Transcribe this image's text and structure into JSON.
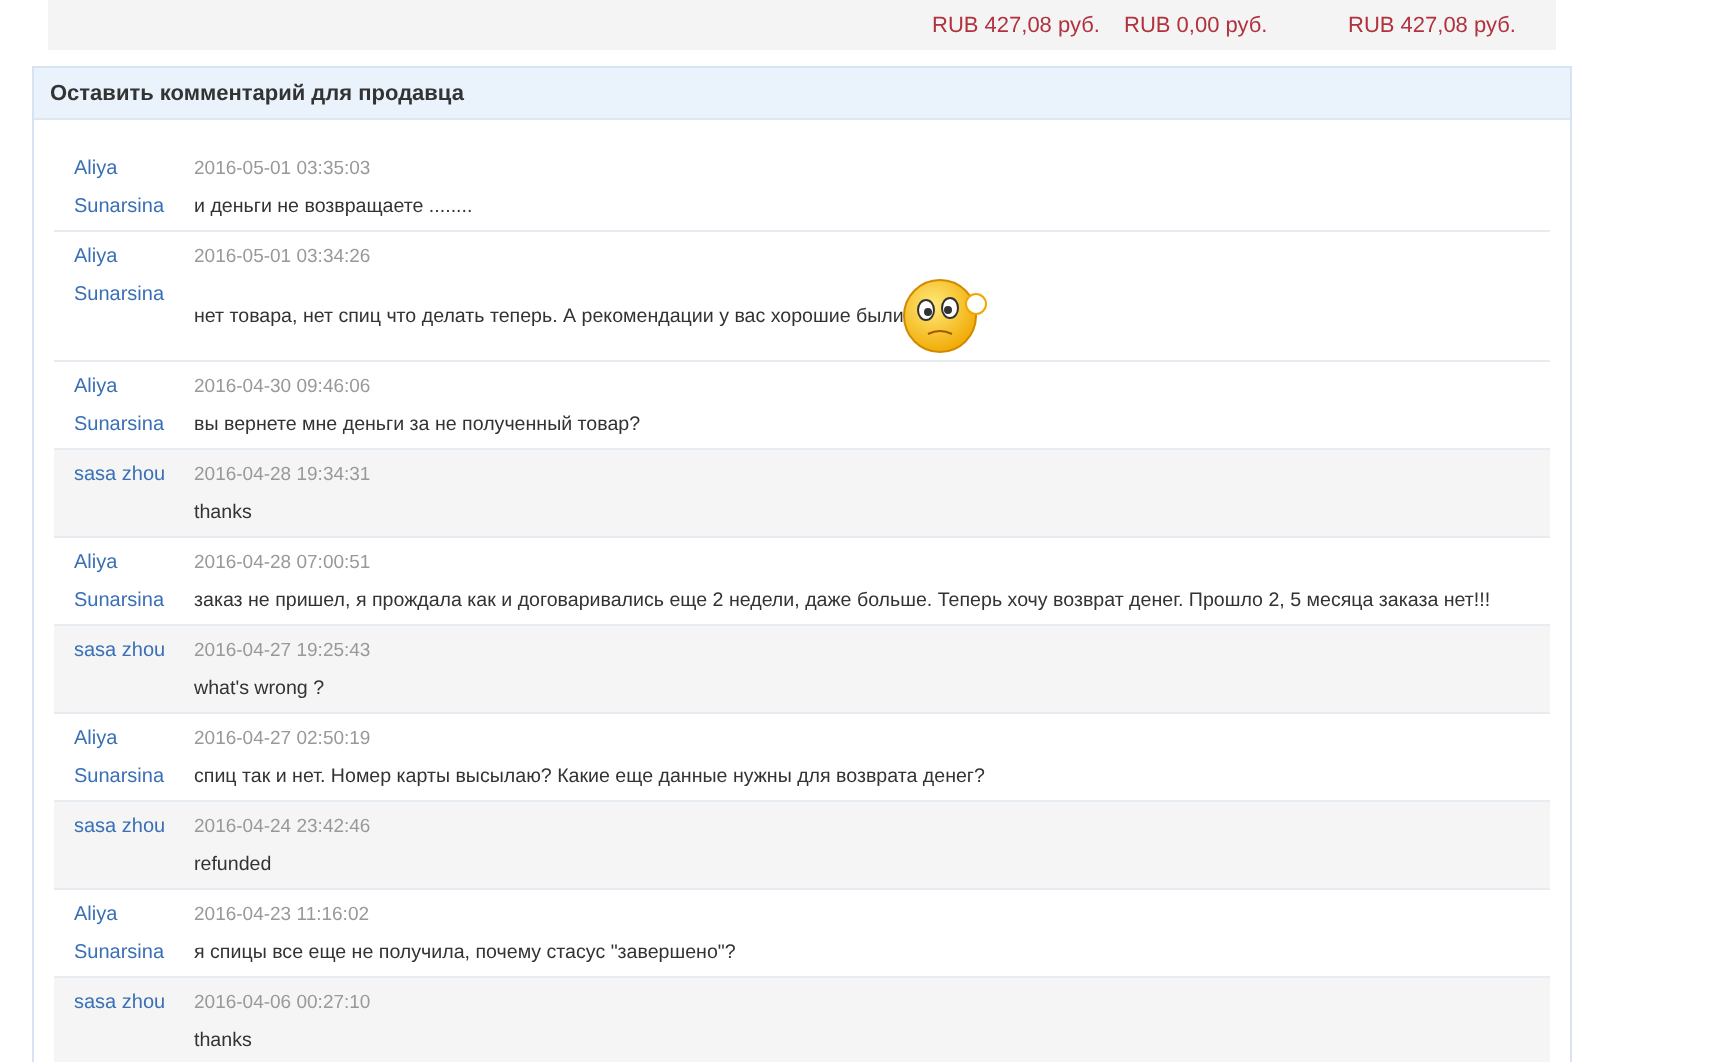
{
  "totals": [
    "RUB 427,08 руб.",
    "RUB 0,00 руб.",
    "RUB 427,08 руб."
  ],
  "comments_panel": {
    "title": "Оставить комментарий для продавца",
    "messages": [
      {
        "kind": "buyer",
        "author": "Aliya Sunarsina",
        "time": "2016-05-01 03:35:03",
        "text": "и деньги не возвращаете ........"
      },
      {
        "kind": "buyer",
        "author": "Aliya Sunarsina",
        "time": "2016-05-01 03:34:26",
        "text": "нет товара, нет спиц что делать теперь. А рекомендации у вас хорошие были",
        "emoji": true
      },
      {
        "kind": "buyer",
        "author": "Aliya Sunarsina",
        "time": "2016-04-30 09:46:06",
        "text": "вы вернете мне деньги за не полученный товар?"
      },
      {
        "kind": "seller",
        "author": "sasa zhou",
        "time": "2016-04-28 19:34:31",
        "text": "thanks"
      },
      {
        "kind": "buyer",
        "author": "Aliya Sunarsina",
        "time": "2016-04-28 07:00:51",
        "text": "заказ не пришел, я прождала как и договаривались еще 2 недели, даже больше. Теперь хочу возврат денег. Прошло 2, 5 месяца заказа нет!!!"
      },
      {
        "kind": "seller",
        "author": "sasa zhou",
        "time": "2016-04-27 19:25:43",
        "text": "what's wrong ?"
      },
      {
        "kind": "buyer",
        "author": "Aliya Sunarsina",
        "time": "2016-04-27 02:50:19",
        "text": "спиц так и нет. Номер карты высылаю? Какие еще данные нужны для возврата денег?"
      },
      {
        "kind": "seller",
        "author": "sasa zhou",
        "time": "2016-04-24 23:42:46",
        "text": "refunded"
      },
      {
        "kind": "buyer",
        "author": "Aliya Sunarsina",
        "time": "2016-04-23 11:16:02",
        "text": "я спицы все еще не получила, почему стасус \"завершено\"?"
      },
      {
        "kind": "seller",
        "author": "sasa zhou",
        "time": "2016-04-06 00:27:10",
        "text": "thanks"
      }
    ]
  }
}
